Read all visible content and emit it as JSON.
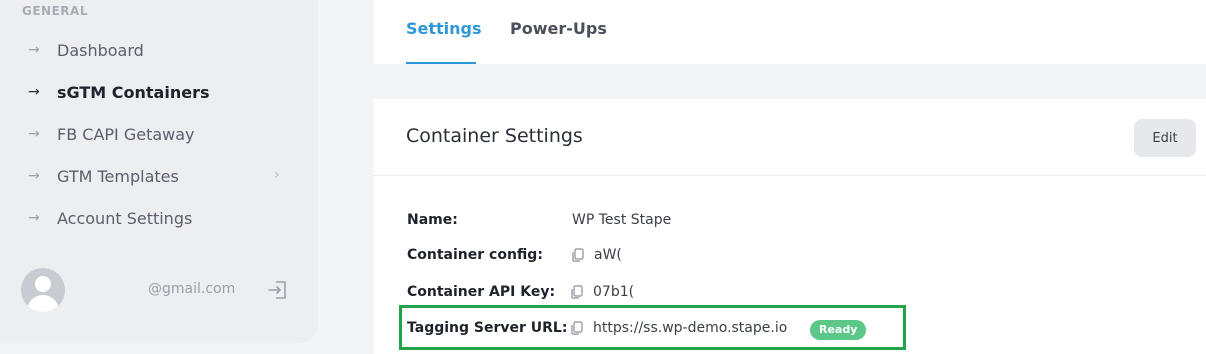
{
  "sidebar": {
    "section_label": "GENERAL",
    "items": [
      {
        "label": "Dashboard",
        "icon": "arrow-right-icon"
      },
      {
        "label": "sGTM Containers",
        "icon": "arrow-right-icon",
        "active": true
      },
      {
        "label": "FB CAPI Getaway",
        "icon": "arrow-right-icon"
      },
      {
        "label": "GTM Templates",
        "icon": "arrow-right-icon",
        "has_submenu": true
      },
      {
        "label": "Account Settings",
        "icon": "arrow-right-icon"
      }
    ],
    "user": {
      "email": "@gmail.com",
      "avatar": "avatar-placeholder-icon",
      "logout_icon": "logout-icon"
    }
  },
  "tabs": [
    {
      "label": "Settings",
      "active": true
    },
    {
      "label": "Power-Ups",
      "active": false
    }
  ],
  "card": {
    "title": "Container Settings",
    "edit_label": "Edit",
    "fields": {
      "name": {
        "label": "Name:",
        "value": "WP Test Stape"
      },
      "container_config": {
        "label": "Container config:",
        "value": "aW("
      },
      "container_api_key": {
        "label": "Container API Key:",
        "value": "07b1("
      },
      "tagging_server_url": {
        "label": "Tagging Server URL:",
        "value": "https://ss.wp-demo.stape.io",
        "status": "Ready"
      }
    }
  },
  "colors": {
    "accent": "#2e97d8",
    "status_ready": "#5bc88a",
    "highlight": "#23a34a"
  }
}
